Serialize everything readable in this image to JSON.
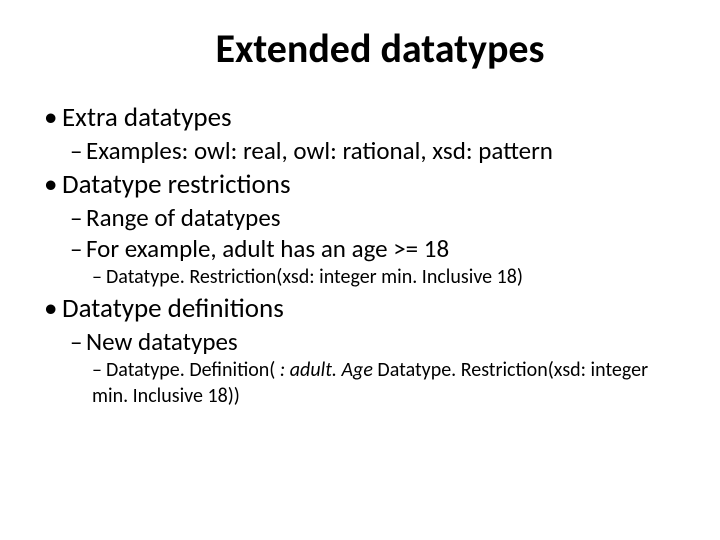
{
  "title": "Extended datatypes",
  "items": {
    "b1": "Extra datatypes",
    "b1_1": "Examples: owl: real, owl: rational, xsd: pattern",
    "b2": "Datatype restrictions",
    "b2_1": "Range of datatypes",
    "b2_2": "For example, adult has an age >= 18",
    "b2_2_1": "Datatype. Restriction(xsd: integer min. Inclusive 18)",
    "b3": "Datatype definitions",
    "b3_1": "New datatypes",
    "b3_1_1a": "Datatype. Definition( ",
    "b3_1_1b": ": adult. Age",
    "b3_1_1c": " Datatype. Restriction(xsd: integer min. Inclusive 18))"
  }
}
